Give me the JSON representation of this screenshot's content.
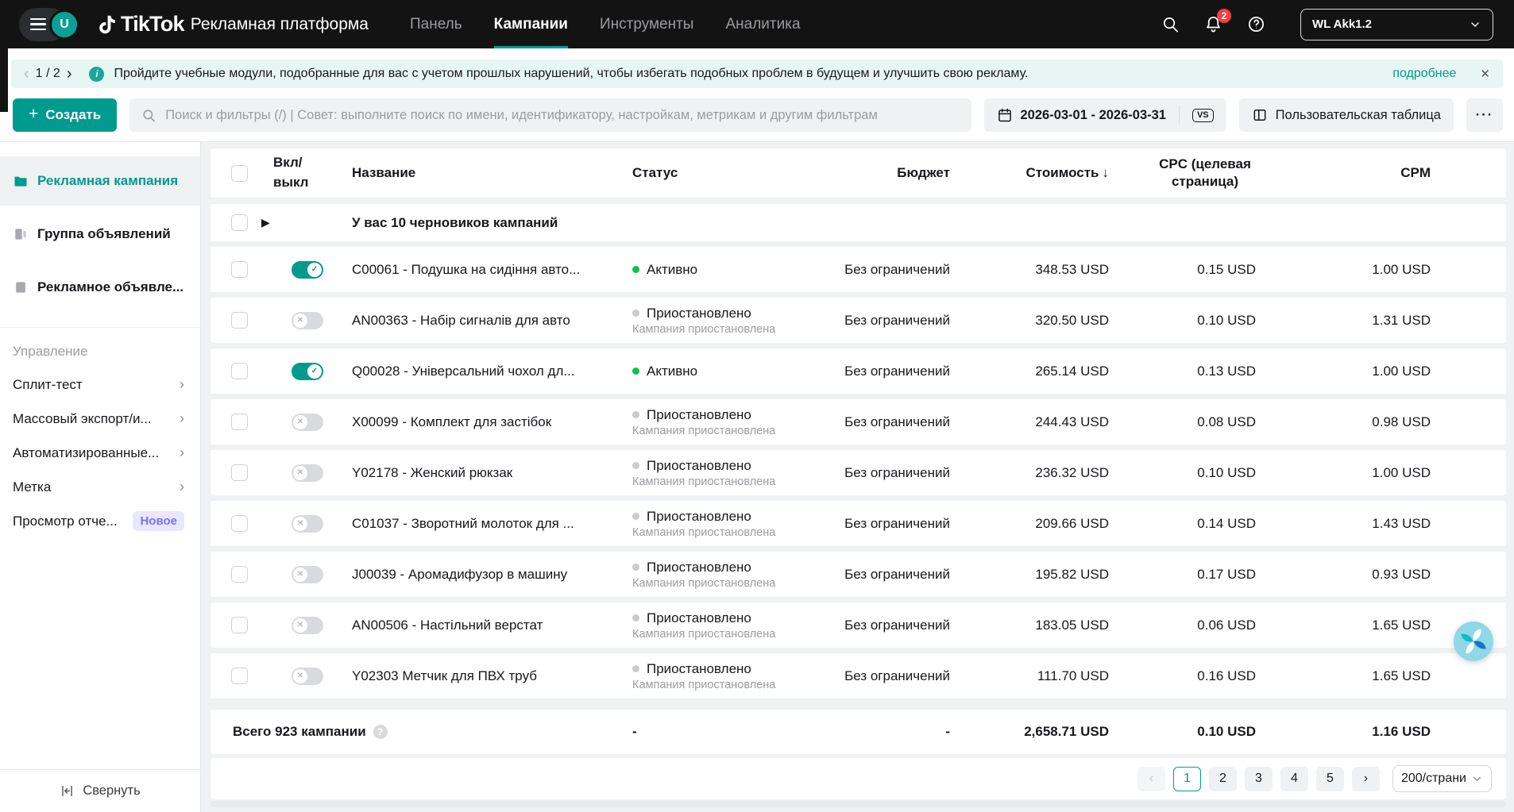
{
  "colors": {
    "accent_teal": "#009a8f",
    "status_green": "#0ac24e",
    "notification_red": "#f53f3f",
    "new_badge_purple": "#7b70f0",
    "banner_bg": "#e7f6f3",
    "topbar_bg": "#131313"
  },
  "topbar": {
    "brand": "TikTok",
    "platform": "Рекламная платформа",
    "avatar_letter": "U",
    "nav": [
      {
        "label": "Панель"
      },
      {
        "label": "Кампании"
      },
      {
        "label": "Инструменты"
      },
      {
        "label": "Аналитика"
      }
    ],
    "notifications_badge": "2",
    "account_name": "WL Akk1.2"
  },
  "banner": {
    "prev": "‹",
    "pager": "1 / 2",
    "next": "›",
    "info_glyph": "i",
    "message": "Пройдите учебные модули, подобранные для вас с учетом прошлых нарушений, чтобы избегать подобных проблем в будущем и улучшить свою рекламу.",
    "link_label": "подробнее",
    "close": "✕"
  },
  "toolbar": {
    "create_plus": "+",
    "create_label": "Создать",
    "search_placeholder": "Поиск и фильтры (/) | Совет: выполните поиск по имени, идентификатору, настройкам, метрикам и другим фильтрам",
    "date_range": "2026-03-01 - 2026-03-31",
    "vs_label": "VS",
    "custom_table_label": "Пользовательская таблица",
    "more_label": "···"
  },
  "sidebar": {
    "top_items": [
      {
        "label": "Рекламная кампания"
      },
      {
        "label": "Группа объявлений"
      },
      {
        "label": "Рекламное объявле..."
      }
    ],
    "section_title": "Управление",
    "management_items": [
      {
        "label": "Сплит-тест"
      },
      {
        "label": "Массовый экспорт/и..."
      },
      {
        "label": "Автоматизированные..."
      },
      {
        "label": "Метка"
      },
      {
        "label": "Просмотр отче..."
      }
    ],
    "new_badge": "Новое",
    "chevron": "›",
    "collapse_label": "Свернуть"
  },
  "table": {
    "columns": {
      "on_off": "Вкл/ выкл",
      "name": "Название",
      "status": "Статус",
      "budget": "Бюджет",
      "cost": "Стоимость",
      "cpc": "CPC (целевая страница)",
      "cpm": "CPM"
    },
    "sort_arrow": "↓",
    "draft_expander": "▶",
    "draft_notice": "У вас 10 черновиков кампаний",
    "rows": [
      {
        "on": true,
        "active": true,
        "name": "C00061 - Подушка на сидіння авто...",
        "status": "Активно",
        "status_sub": "",
        "budget": "Без ограничений",
        "cost": "348.53 USD",
        "cpc": "0.15 USD",
        "cpm": "1.00 USD"
      },
      {
        "on": false,
        "active": false,
        "name": "AN00363 - Набір сигналів для авто",
        "status": "Приостановлено",
        "status_sub": "Кампания приостановлена",
        "budget": "Без ограничений",
        "cost": "320.50 USD",
        "cpc": "0.10 USD",
        "cpm": "1.31 USD"
      },
      {
        "on": true,
        "active": true,
        "name": "Q00028 - Універсальний чохол дл...",
        "status": "Активно",
        "status_sub": "",
        "budget": "Без ограничений",
        "cost": "265.14 USD",
        "cpc": "0.13 USD",
        "cpm": "1.00 USD"
      },
      {
        "on": false,
        "active": false,
        "name": "X00099 - Комплект для застібок",
        "status": "Приостановлено",
        "status_sub": "Кампания приостановлена",
        "budget": "Без ограничений",
        "cost": "244.43 USD",
        "cpc": "0.08 USD",
        "cpm": "0.98 USD"
      },
      {
        "on": false,
        "active": false,
        "name": "Y02178 - Женский рюкзак",
        "status": "Приостановлено",
        "status_sub": "Кампания приостановлена",
        "budget": "Без ограничений",
        "cost": "236.32 USD",
        "cpc": "0.10 USD",
        "cpm": "1.00 USD"
      },
      {
        "on": false,
        "active": false,
        "name": "C01037 - Зворотний молоток для ...",
        "status": "Приостановлено",
        "status_sub": "Кампания приостановлена",
        "budget": "Без ограничений",
        "cost": "209.66 USD",
        "cpc": "0.14 USD",
        "cpm": "1.43 USD"
      },
      {
        "on": false,
        "active": false,
        "name": "J00039 - Аромадифузор в машину",
        "status": "Приостановлено",
        "status_sub": "Кампания приостановлена",
        "budget": "Без ограничений",
        "cost": "195.82 USD",
        "cpc": "0.17 USD",
        "cpm": "0.93 USD"
      },
      {
        "on": false,
        "active": false,
        "name": "AN00506 - Настільний верстат",
        "status": "Приостановлено",
        "status_sub": "Кампания приостановлена",
        "budget": "Без ограничений",
        "cost": "183.05 USD",
        "cpc": "0.06 USD",
        "cpm": "1.65 USD"
      },
      {
        "on": false,
        "active": false,
        "name": "Y02303 Метчик для ПВХ труб",
        "status": "Приостановлено",
        "status_sub": "Кампания приостановлена",
        "budget": "Без ограничений",
        "cost": "111.70 USD",
        "cpc": "0.16 USD",
        "cpm": "1.65 USD"
      }
    ],
    "totals": {
      "label": "Всего 923 кампании",
      "help_glyph": "?",
      "status": "-",
      "budget": "-",
      "cost": "2,658.71 USD",
      "cpc": "0.10 USD",
      "cpm": "1.16 USD"
    }
  },
  "pagination": {
    "prev": "‹",
    "next": "›",
    "pages": [
      "1",
      "2",
      "3",
      "4",
      "5"
    ],
    "active_page": "1",
    "page_size": "200/страни"
  }
}
